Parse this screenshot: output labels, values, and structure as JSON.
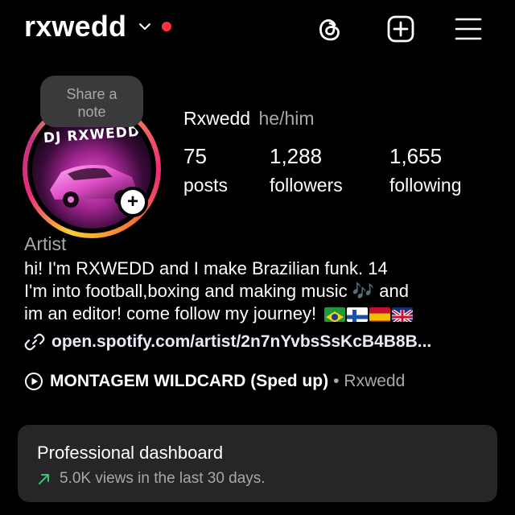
{
  "header": {
    "username": "rxwedd",
    "icons": [
      "chevron-down-icon",
      "notification-dot",
      "threads-icon",
      "new-post-icon",
      "menu-icon"
    ]
  },
  "note_bubble": {
    "text": "Share a note"
  },
  "profile": {
    "display_name": "Rxwedd",
    "pronouns": "he/him",
    "avatar_text": "DJ RXWEDD"
  },
  "stats": [
    {
      "value": "75",
      "label": "posts"
    },
    {
      "value": "1,288",
      "label": "followers"
    },
    {
      "value": "1,655",
      "label": "following"
    }
  ],
  "bio": {
    "category": "Artist",
    "line1": "hi! I'm RXWEDD and I make Brazilian funk. 14",
    "line2a": "I'm into football,boxing and making music",
    "music_emoji": "🎶",
    "line2b": "and",
    "line3": "im an editor! come follow my journey!",
    "flags": [
      "brazil",
      "finland",
      "spain",
      "united-kingdom"
    ],
    "link": "open.spotify.com/artist/2n7nYvbsSsKcB4B8B..."
  },
  "music": {
    "track": "MONTAGEM WILDCARD (Sped up)",
    "separator": "•",
    "artist": "Rxwedd"
  },
  "dashboard": {
    "title": "Professional dashboard",
    "subtitle": "5.0K views in the last 30 days.",
    "trend_icon": "trending-up-icon",
    "trend_color": "#3ec46d"
  },
  "colors": {
    "background": "#000000",
    "secondary_text": "#a8a8a8",
    "notification_dot": "#ff3040",
    "card": "#262628"
  }
}
